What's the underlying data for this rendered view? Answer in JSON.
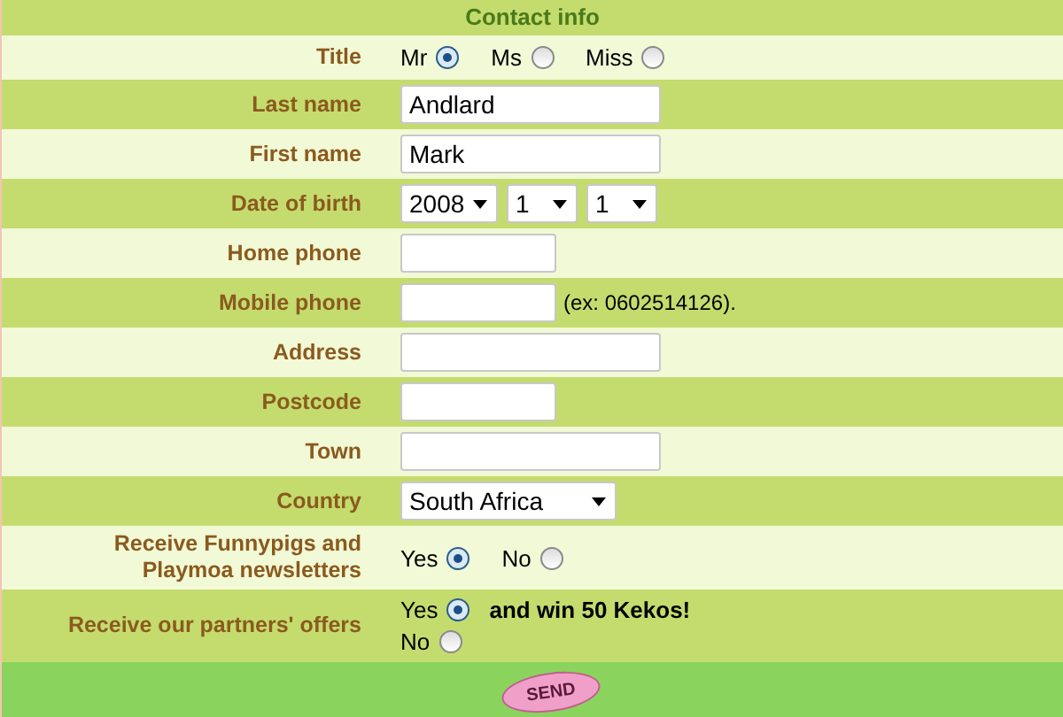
{
  "header": "Contact info",
  "fields": [
    {
      "kind": "radio",
      "label": "Title",
      "options": [
        {
          "label": "Mr",
          "selected": true
        },
        {
          "label": "Ms",
          "selected": false
        },
        {
          "label": "Miss",
          "selected": false
        }
      ]
    },
    {
      "kind": "textbox",
      "label": "Last name",
      "value": "Andlard"
    },
    {
      "kind": "textbox",
      "label": "First name",
      "value": "Mark"
    },
    {
      "kind": "dates",
      "label": "Date of birth",
      "selects": [
        {
          "value": "2008"
        },
        {
          "value": "1"
        },
        {
          "value": "1"
        }
      ]
    },
    {
      "kind": "shortbox",
      "label": "Home phone"
    },
    {
      "kind": "shortbox",
      "label": "Mobile phone",
      "hint": "(ex: 0602514126)."
    },
    {
      "kind": "textbox",
      "label": "Address"
    },
    {
      "kind": "shortbox",
      "label": "Postcode"
    },
    {
      "kind": "textbox",
      "label": "Town"
    },
    {
      "kind": "select",
      "label": "Country",
      "value": "South Africa"
    },
    {
      "kind": "radio",
      "label": "Receive Funnypigs and Playmoa newsletters",
      "options": [
        {
          "label": "Yes",
          "selected": true
        },
        {
          "label": "No",
          "selected": false
        }
      ]
    },
    {
      "kind": "radiostack",
      "label": "Receive our partners' offers",
      "options": [
        {
          "label": "Yes",
          "selected": true,
          "note": "and win 50 Kekos!"
        },
        {
          "label": "No",
          "selected": false
        }
      ]
    }
  ],
  "send_button": "SEND"
}
